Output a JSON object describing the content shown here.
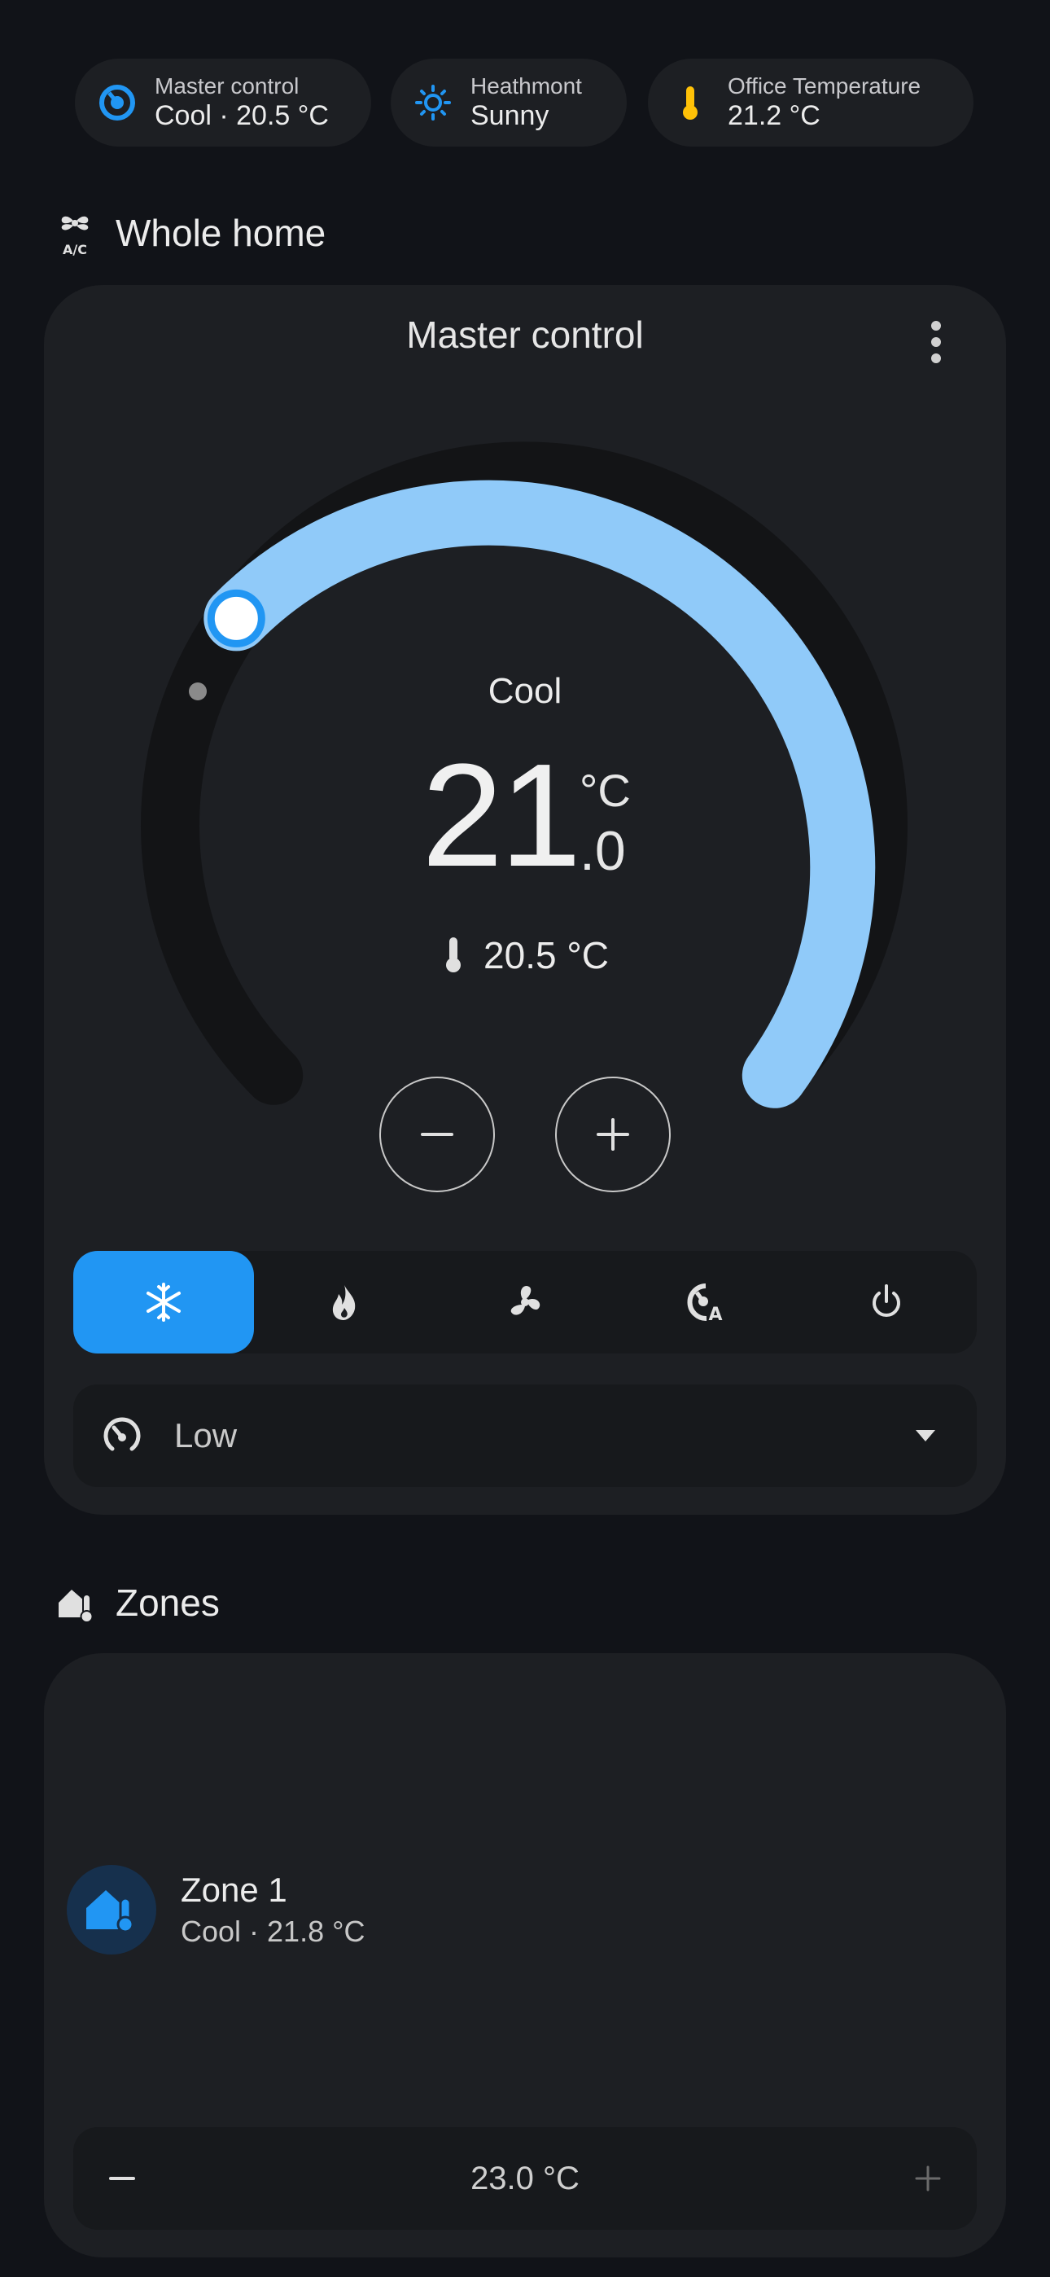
{
  "badges": [
    {
      "name": "Master control",
      "state": "Cool · 20.5 °C",
      "icon": "thermostat-auto-icon",
      "color": "#2196f3"
    },
    {
      "name": "Heathmont",
      "state": "Sunny",
      "icon": "sun-icon",
      "color": "#2196f3"
    },
    {
      "name": "Office Temperature",
      "state": "21.2 °C",
      "icon": "thermometer-icon",
      "color": "#ffc107"
    }
  ],
  "sections": {
    "whole_home": {
      "title": "Whole home",
      "icon": "air-conditioner-icon"
    },
    "zones": {
      "title": "Zones",
      "icon": "home-thermometer-icon"
    }
  },
  "thermostat": {
    "title": "Master control",
    "mode": "Cool",
    "target_integer": "21",
    "target_decimal": ".0",
    "unit": "°C",
    "current": "20.5 °C",
    "target_value": 21.0,
    "accent": "#90caf9",
    "modes": [
      {
        "name": "cool",
        "icon": "snowflake-icon",
        "active": true
      },
      {
        "name": "heat",
        "icon": "fire-icon",
        "active": false
      },
      {
        "name": "fan_only",
        "icon": "fan-icon",
        "active": false
      },
      {
        "name": "auto",
        "icon": "thermostat-auto-icon",
        "active": false
      },
      {
        "name": "off",
        "icon": "power-icon",
        "active": false
      }
    ],
    "active_color": "#2196f3",
    "fan_mode": "Low"
  },
  "zone": {
    "name": "Zone 1",
    "state": "Cool · 21.8 °C",
    "target": "23.0 °C",
    "color": "#2196f3"
  }
}
